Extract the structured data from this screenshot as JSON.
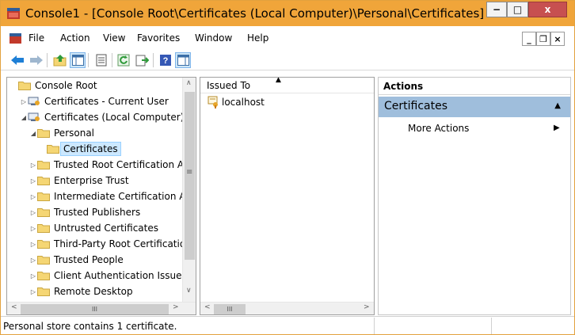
{
  "window": {
    "title": "Console1 - [Console Root\\Certificates (Local Computer)\\Personal\\Certificates]",
    "min_glyph": "−",
    "max_glyph": "□",
    "close_glyph": "x"
  },
  "menu": {
    "items": [
      "File",
      "Action",
      "View",
      "Favorites",
      "Window",
      "Help"
    ],
    "mdi_min": "_",
    "mdi_restore": "❐",
    "mdi_close": "×"
  },
  "toolbar": {
    "buttons": [
      "back-icon",
      "forward-icon",
      "up-folder-icon",
      "show-hide-tree-icon",
      "properties-icon",
      "refresh-icon",
      "export-list-icon",
      "help-icon",
      "show-hide-action-pane-icon"
    ]
  },
  "tree": {
    "items": [
      {
        "label": "Console Root",
        "level": 0,
        "expander": "",
        "icon": "folder-icon",
        "selected": false
      },
      {
        "label": "Certificates - Current User",
        "level": 1,
        "expander": "▷",
        "icon": "certificates-snapin-icon",
        "selected": false
      },
      {
        "label": "Certificates (Local Computer)",
        "level": 1,
        "expander": "◢",
        "icon": "certificates-snapin-icon",
        "selected": false
      },
      {
        "label": "Personal",
        "level": 2,
        "expander": "◢",
        "icon": "folder-icon",
        "selected": false
      },
      {
        "label": "Certificates",
        "level": 3,
        "expander": "",
        "icon": "folder-icon",
        "selected": true
      },
      {
        "label": "Trusted Root Certification Authorities",
        "level": 2,
        "expander": "▷",
        "icon": "folder-icon",
        "selected": false
      },
      {
        "label": "Enterprise Trust",
        "level": 2,
        "expander": "▷",
        "icon": "folder-icon",
        "selected": false
      },
      {
        "label": "Intermediate Certification Authorities",
        "level": 2,
        "expander": "▷",
        "icon": "folder-icon",
        "selected": false
      },
      {
        "label": "Trusted Publishers",
        "level": 2,
        "expander": "▷",
        "icon": "folder-icon",
        "selected": false
      },
      {
        "label": "Untrusted Certificates",
        "level": 2,
        "expander": "▷",
        "icon": "folder-icon",
        "selected": false
      },
      {
        "label": "Third-Party Root Certification Authorities",
        "level": 2,
        "expander": "▷",
        "icon": "folder-icon",
        "selected": false
      },
      {
        "label": "Trusted People",
        "level": 2,
        "expander": "▷",
        "icon": "folder-icon",
        "selected": false
      },
      {
        "label": "Client Authentication Issuers",
        "level": 2,
        "expander": "▷",
        "icon": "folder-icon",
        "selected": false
      },
      {
        "label": "Remote Desktop",
        "level": 2,
        "expander": "▷",
        "icon": "folder-icon",
        "selected": false
      }
    ],
    "scroll_up": "∧",
    "scroll_down": "∨",
    "scroll_grip": "≡",
    "scroll_left": "<",
    "scroll_right": ">",
    "hgrip": "III"
  },
  "list": {
    "column_header": "Issued To",
    "sort_glyph": "▲",
    "rows": [
      "localhost"
    ],
    "scroll_left": "<",
    "scroll_right": ">",
    "hgrip": "III"
  },
  "actions": {
    "header": "Actions",
    "group": "Certificates",
    "group_glyph": "▲",
    "items": [
      "More Actions"
    ],
    "item_glyph": "▶"
  },
  "status": {
    "text": "Personal store contains 1 certificate."
  },
  "colors": {
    "titlebar": "#f0a53a",
    "close_button": "#c75050",
    "selection": "#cce8ff",
    "action_group": "#9fbedc",
    "folder": "#f5d674"
  }
}
